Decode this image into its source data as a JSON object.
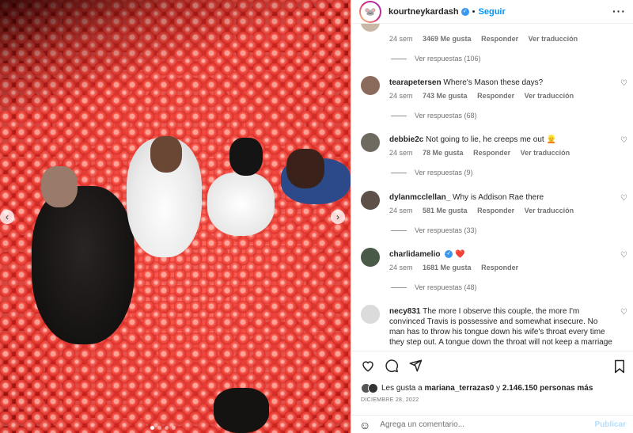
{
  "post": {
    "username": "kourtneykardash",
    "follow_label": "Seguir",
    "dot": "•",
    "more": "···"
  },
  "comments": [
    {
      "username": "",
      "text": "",
      "time": "24 sem",
      "likes": "3469 Me gusta",
      "reply": "Responder",
      "translate": "Ver traducción",
      "replies": "Ver respuestas (106)"
    },
    {
      "username": "tearapetersen",
      "text": "Where's Mason these days?",
      "time": "24 sem",
      "likes": "743 Me gusta",
      "reply": "Responder",
      "translate": "Ver traducción",
      "replies": "Ver respuestas (68)"
    },
    {
      "username": "debbie2c",
      "text": "Not going to lie, he creeps me out 👱",
      "time": "24 sem",
      "likes": "78 Me gusta",
      "reply": "Responder",
      "translate": "Ver traducción",
      "replies": "Ver respuestas (9)"
    },
    {
      "username": "dylanmcclellan_",
      "text": "Why is Addison Rae there",
      "time": "24 sem",
      "likes": "581 Me gusta",
      "reply": "Responder",
      "translate": "Ver traducción",
      "replies": "Ver respuestas (33)"
    },
    {
      "username": "charlidamelio",
      "text": "❤️",
      "time": "24 sem",
      "likes": "1681 Me gusta",
      "reply": "Responder",
      "translate": "",
      "replies": "Ver respuestas (48)"
    },
    {
      "username": "necy831",
      "text": "The more I observe this couple, the more I'm convinced Travis is possessive and somewhat insecure. No man has to throw his tongue down his wife's throat every time they step out. A tongue down the throat will not keep a marriage",
      "time": "",
      "likes": "",
      "reply": "",
      "translate": "",
      "replies": ""
    }
  ],
  "likes_summary": {
    "prefix": "Les gusta a",
    "user": "mariana_terrazas0",
    "conjunction": "y",
    "count": "2.146.150 personas más"
  },
  "date": "DICIEMBRE 28, 2022",
  "add_comment": {
    "placeholder": "Agrega un comentario...",
    "publish": "Publicar"
  },
  "colors": {
    "accent": "#0095f6",
    "verified": "#3897f0",
    "heart": "#ed4956"
  }
}
